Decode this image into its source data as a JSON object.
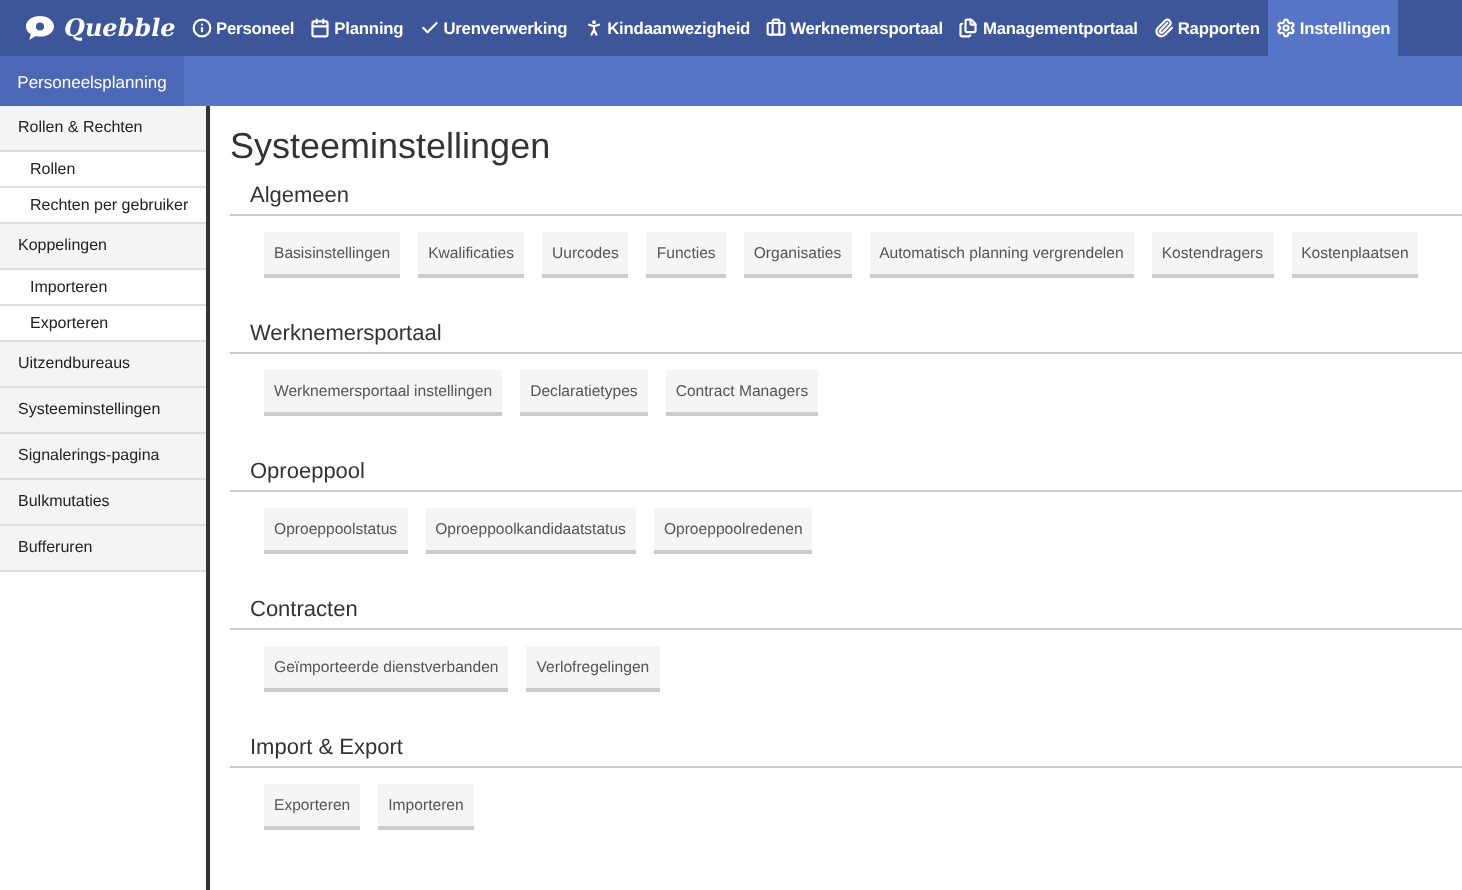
{
  "brand": {
    "logo": "Quebble",
    "subtitle": "Personeelsplanning"
  },
  "nav": [
    {
      "label": "Personeel",
      "selected": false
    },
    {
      "label": "Planning",
      "selected": false
    },
    {
      "label": "Urenverwerking",
      "selected": false
    },
    {
      "label": "Kindaanwezigheid",
      "selected": false
    },
    {
      "label": "Werknemersportaal",
      "selected": false
    },
    {
      "label": "Managementportaal",
      "selected": false
    },
    {
      "label": "Rapporten",
      "selected": false
    },
    {
      "label": "Instellingen",
      "selected": true
    }
  ],
  "sidebar": {
    "items": [
      {
        "label": "Rollen & Rechten",
        "children": [
          {
            "label": "Rollen"
          },
          {
            "label": "Rechten per gebruiker"
          }
        ]
      },
      {
        "label": "Koppelingen",
        "children": [
          {
            "label": "Importeren"
          },
          {
            "label": "Exporteren"
          }
        ]
      },
      {
        "label": "Uitzendbureaus"
      },
      {
        "label": "Systeeminstellingen"
      },
      {
        "label": "Signalerings-pagina"
      },
      {
        "label": "Bulkmutaties"
      },
      {
        "label": "Bufferuren"
      }
    ]
  },
  "page_title": "Systeeminstellingen",
  "sections": [
    {
      "title": "Algemeen",
      "buttons": [
        "Basisinstellingen",
        "Kwalificaties",
        "Uurcodes",
        "Functies",
        "Organisaties",
        "Automatisch planning vergrendelen",
        "Kostendragers",
        "Kostenplaatsen"
      ]
    },
    {
      "title": "Werknemersportaal",
      "buttons": [
        "Werknemersportaal instellingen",
        "Declaratietypes",
        "Contract Managers"
      ]
    },
    {
      "title": "Oproeppool",
      "buttons": [
        "Oproeppoolstatus",
        "Oproeppoolkandidaatstatus",
        "Oproeppoolredenen"
      ]
    },
    {
      "title": "Contracten",
      "buttons": [
        "Geïmporteerde dienstverbanden",
        "Verlofregelingen"
      ]
    },
    {
      "title": "Import & Export",
      "buttons": [
        "Exporteren",
        "Importeren"
      ]
    }
  ]
}
